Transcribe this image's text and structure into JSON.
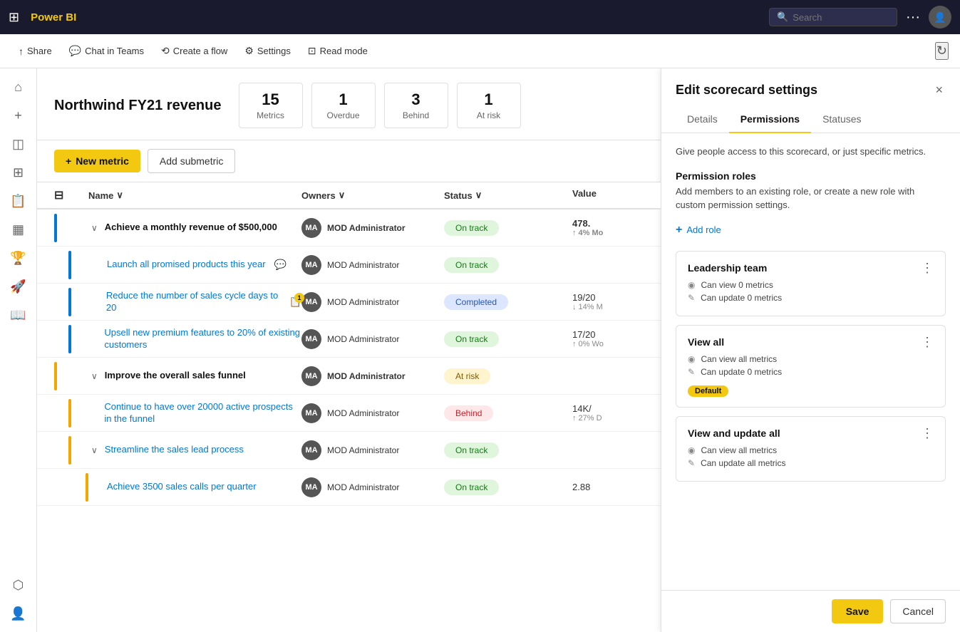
{
  "topbar": {
    "app_name": "Power BI",
    "search_placeholder": "Search",
    "dots": "···"
  },
  "toolbar": {
    "share_label": "Share",
    "chat_in_teams_label": "Chat in Teams",
    "create_flow_label": "Create a flow",
    "settings_label": "Settings",
    "read_mode_label": "Read mode"
  },
  "scorecard": {
    "title": "Northwind FY21 revenue",
    "metrics_count": "15",
    "metrics_label": "Metrics",
    "overdue_count": "1",
    "overdue_label": "Overdue",
    "behind_count": "3",
    "behind_label": "Behind",
    "at_risk_count": "1",
    "at_risk_label": "At risk"
  },
  "actions": {
    "new_metric": "New metric",
    "add_submetric": "Add submetric"
  },
  "table": {
    "col_name": "Name",
    "col_owners": "Owners",
    "col_status": "Status",
    "col_value": "Value",
    "rows": [
      {
        "id": 1,
        "indent": 0,
        "expandable": true,
        "color": "#0078d4",
        "name": "Achieve a monthly revenue of $500,000",
        "owner": "MOD Administrator",
        "owner_initials": "MA",
        "status": "On track",
        "status_class": "status-on-track",
        "value": "478.",
        "value_sub": "↑ 4% Mo",
        "has_chat": false,
        "has_notify": false
      },
      {
        "id": 2,
        "indent": 1,
        "expandable": false,
        "color": "#0078d4",
        "name": "Launch all promised products this year",
        "owner": "MOD Administrator",
        "owner_initials": "MA",
        "status": "On track",
        "status_class": "status-on-track",
        "value": "",
        "value_sub": "",
        "has_chat": true,
        "has_notify": false
      },
      {
        "id": 3,
        "indent": 1,
        "expandable": false,
        "color": "#0078d4",
        "name": "Reduce the number of sales cycle days to 20",
        "owner": "MOD Administrator",
        "owner_initials": "MA",
        "status": "Completed",
        "status_class": "status-completed",
        "value": "19/20",
        "value_sub": "↓ 14% M",
        "has_chat": false,
        "has_notify": true,
        "notify_count": "1"
      },
      {
        "id": 4,
        "indent": 1,
        "expandable": false,
        "color": "#0078d4",
        "name": "Upsell new premium features to 20% of existing customers",
        "owner": "MOD Administrator",
        "owner_initials": "MA",
        "status": "On track",
        "status_class": "status-on-track",
        "value": "17/20",
        "value_sub": "↑ 0% Wo",
        "has_chat": false,
        "has_notify": false
      },
      {
        "id": 5,
        "indent": 0,
        "expandable": true,
        "color": "#f2a600",
        "name": "Improve the overall sales funnel",
        "owner": "MOD Administrator",
        "owner_initials": "MA",
        "status": "At risk",
        "status_class": "status-at-risk",
        "value": "",
        "value_sub": "",
        "has_chat": false,
        "has_notify": false
      },
      {
        "id": 6,
        "indent": 1,
        "expandable": false,
        "color": "#f2a600",
        "name": "Continue to have over 20000 active prospects in the funnel",
        "owner": "MOD Administrator",
        "owner_initials": "MA",
        "status": "Behind",
        "status_class": "status-behind",
        "value": "14K/",
        "value_sub": "↑ 27% D",
        "has_chat": false,
        "has_notify": false
      },
      {
        "id": 7,
        "indent": 1,
        "expandable": true,
        "color": "#f2a600",
        "name": "Streamline the sales lead process",
        "owner": "MOD Administrator",
        "owner_initials": "MA",
        "status": "On track",
        "status_class": "status-on-track",
        "value": "",
        "value_sub": "",
        "has_chat": false,
        "has_notify": false
      },
      {
        "id": 8,
        "indent": 2,
        "expandable": false,
        "color": "#f2a600",
        "name": "Achieve 3500 sales calls per quarter",
        "owner": "MOD Administrator",
        "owner_initials": "MA",
        "status": "On track",
        "status_class": "status-on-track",
        "value": "2.88",
        "value_sub": "",
        "has_chat": false,
        "has_notify": false
      }
    ]
  },
  "panel": {
    "title": "Edit scorecard settings",
    "tabs": [
      "Details",
      "Permissions",
      "Statuses"
    ],
    "active_tab": "Permissions",
    "description": "Give people access to this scorecard, or just specific metrics.",
    "permission_roles_title": "Permission roles",
    "permission_roles_desc": "Add members to an existing role, or create a new role with custom permission settings.",
    "add_role_label": "Add role",
    "roles": [
      {
        "name": "Leadership team",
        "perms": [
          "Can view 0 metrics",
          "Can update 0 metrics"
        ],
        "is_default": false
      },
      {
        "name": "View all",
        "perms": [
          "Can view all metrics",
          "Can update 0 metrics"
        ],
        "is_default": true,
        "default_label": "Default"
      },
      {
        "name": "View and update all",
        "perms": [
          "Can view all metrics",
          "Can update all metrics"
        ],
        "is_default": false
      }
    ],
    "save_label": "Save",
    "cancel_label": "Cancel"
  },
  "icons": {
    "grid": "⊞",
    "search": "🔍",
    "home": "⌂",
    "plus": "+",
    "browse": "◫",
    "data": "⊞",
    "report": "📋",
    "dashboard": "▦",
    "rocket": "🚀",
    "book": "📖",
    "apps": "⬡",
    "person": "👤",
    "share": "↑",
    "teams": "T",
    "flow": "⟲",
    "gear": "⚙",
    "eye": "⊡",
    "refresh": "↻",
    "filter": "⊟",
    "chevron_down": "∨",
    "chevron_right": "›",
    "eye_icon": "◉",
    "edit_icon": "✎",
    "close": "×",
    "ellipsis": "⋮",
    "add": "+",
    "chat": "💬",
    "bell": "🔔"
  }
}
